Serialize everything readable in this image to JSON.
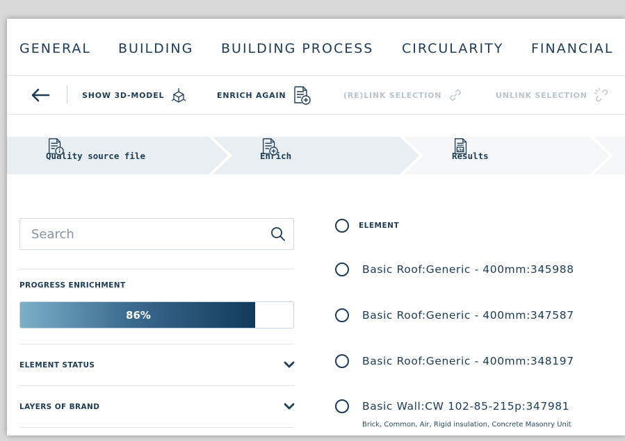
{
  "nav": {
    "tabs": [
      "GENERAL",
      "BUILDING",
      "BUILDING PROCESS",
      "CIRCULARITY",
      "FINANCIAL"
    ]
  },
  "toolbar": {
    "show_3d_model": "SHOW 3D-MODEL",
    "enrich_again": "ENRICH AGAIN",
    "relink_selection": "(RE)LINK SELECTION",
    "unlink_selection": "UNLINK SELECTION"
  },
  "steps": [
    {
      "label": "Quality source file",
      "icon": "document-info-icon"
    },
    {
      "label": "Enrich",
      "icon": "document-add-icon"
    },
    {
      "label": "Results",
      "icon": "document-results-icon"
    }
  ],
  "search": {
    "placeholder": "Search"
  },
  "progress": {
    "label": "PROGRESS ENRICHMENT",
    "value_text": "86%",
    "fraction": 0.86
  },
  "filters": {
    "element_status": "ELEMENT STATUS",
    "layers_of_brand": "LAYERS OF BRAND"
  },
  "elements": {
    "header": "ELEMENT",
    "items": [
      {
        "name": "Basic Roof:Generic - 400mm:345988",
        "materials": ""
      },
      {
        "name": "Basic Roof:Generic - 400mm:347587",
        "materials": ""
      },
      {
        "name": "Basic Roof:Generic - 400mm:348197",
        "materials": ""
      },
      {
        "name": "Basic Wall:CW 102-85-215p:347981",
        "materials": "Brick, Common, Air, Rigid insulation, Concrete Masonry Unit"
      }
    ]
  },
  "colors": {
    "text": "#1d3b55",
    "disabled": "#b9c3cc",
    "step_active": "#e9eef2",
    "step_inactive": "#f4f6f8",
    "progress_start": "#7ab0c8",
    "progress_end": "#123a5c"
  }
}
